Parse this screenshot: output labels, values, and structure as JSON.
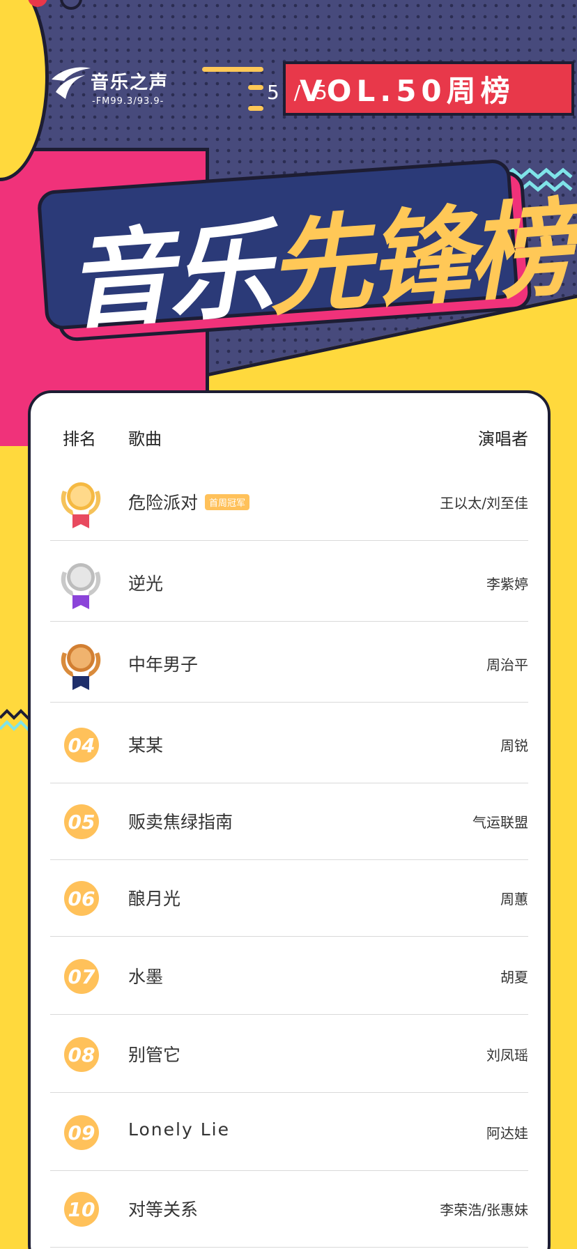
{
  "header": {
    "logo_name": "音乐之声",
    "logo_freq": "-FM99.3/93.9-",
    "page_indicator": "5 / 5",
    "vol_label": "VOL.50周榜",
    "title_white": "音乐",
    "title_yellow": "先锋榜"
  },
  "table": {
    "col_rank": "排名",
    "col_song": "歌曲",
    "col_artist": "演唱者",
    "rows": [
      {
        "rank": "1",
        "song": "危险派对",
        "badge": "首周冠军",
        "artist": "王以太/刘至佳",
        "medal": "gold"
      },
      {
        "rank": "2",
        "song": "逆光",
        "artist": "李紫婷",
        "medal": "silver"
      },
      {
        "rank": "3",
        "song": "中年男子",
        "artist": "周治平",
        "medal": "bronze"
      },
      {
        "rank": "04",
        "song": "某某",
        "artist": "周锐"
      },
      {
        "rank": "05",
        "song": "贩卖焦绿指南",
        "artist": "气运联盟"
      },
      {
        "rank": "06",
        "song": "酿月光",
        "artist": "周蕙"
      },
      {
        "rank": "07",
        "song": "水墨",
        "artist": "胡夏"
      },
      {
        "rank": "08",
        "song": "别管它",
        "artist": "刘凤瑶"
      },
      {
        "rank": "09",
        "song": "Lonely Lie",
        "artist": "阿达娃"
      },
      {
        "rank": "10",
        "song": "对等关系",
        "artist": "李荣浩/张惠妹"
      }
    ]
  },
  "colors": {
    "navy": "#474a7c",
    "pink": "#f0327a",
    "yellow": "#ffd93d",
    "rank_orange": "#ffc15a",
    "red": "#e8384a"
  }
}
